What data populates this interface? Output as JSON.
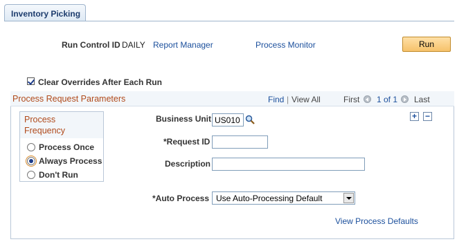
{
  "tab": {
    "label": "Inventory Picking"
  },
  "run_control": {
    "label": "Run Control ID",
    "value": "DAILY",
    "report_manager": "Report Manager",
    "process_monitor": "Process Monitor",
    "run_button": "Run"
  },
  "clear_overrides": {
    "label": "Clear Overrides After Each Run",
    "checked": true
  },
  "params": {
    "title": "Process Request Parameters",
    "find": "Find",
    "sep": "|",
    "view_all": "View All",
    "first": "First",
    "range": "1 of 1",
    "last": "Last"
  },
  "frequency": {
    "title": "Process Frequency",
    "options": [
      "Process Once",
      "Always Process",
      "Don't Run"
    ],
    "selected": "Always Process"
  },
  "fields": {
    "business_unit_label": "Business Unit",
    "business_unit_value": "US010",
    "request_id_label": "*Request ID",
    "request_id_value": "",
    "description_label": "Description",
    "description_value": "",
    "auto_process_label": "*Auto Process",
    "auto_process_value": "Use Auto-Processing Default"
  },
  "add_row": "+",
  "delete_row": "−",
  "view_defaults": "View Process Defaults"
}
